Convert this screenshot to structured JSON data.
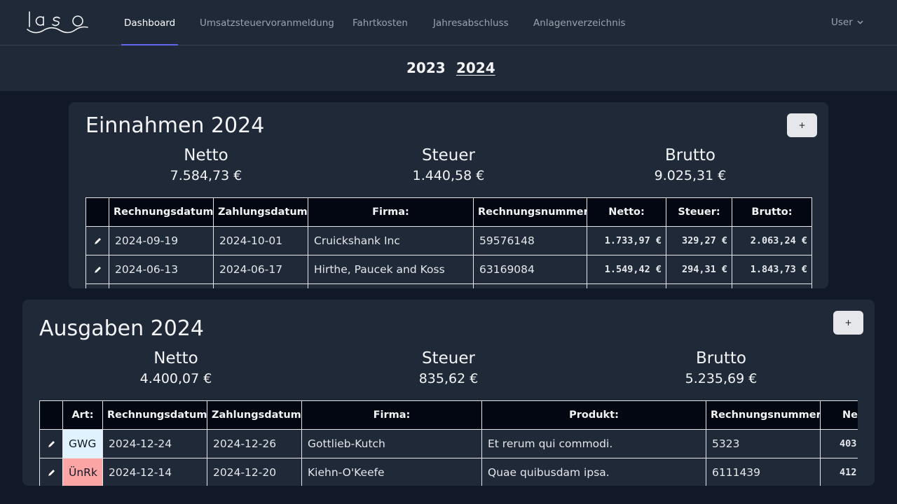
{
  "nav": {
    "items": [
      "Dashboard",
      "Umsatzsteuervoranmeldung",
      "Fahrtkosten",
      "Jahresabschluss",
      "Anlagenverzeichnis"
    ],
    "active": "Dashboard",
    "user_label": "User"
  },
  "years": {
    "items": [
      "2023",
      "2024"
    ],
    "active": "2024"
  },
  "income": {
    "title": "Einnahmen 2024",
    "add_label": "+",
    "summary": {
      "netto_label": "Netto",
      "netto_value": "7.584,73 €",
      "steuer_label": "Steuer",
      "steuer_value": "1.440,58 €",
      "brutto_label": "Brutto",
      "brutto_value": "9.025,31 €"
    },
    "columns": [
      "",
      "Rechnungsdatum:",
      "Zahlungsdatum:",
      "Firma:",
      "Rechnungsnummer:",
      "Netto:",
      "Steuer:",
      "Brutto:"
    ],
    "rows": [
      {
        "rechnungsdatum": "2024-09-19",
        "zahlungsdatum": "2024-10-01",
        "firma": "Cruickshank Inc",
        "rechnungsnummer": "59576148",
        "netto": "1.733,97 €",
        "steuer": "329,27 €",
        "brutto": "2.063,24 €"
      },
      {
        "rechnungsdatum": "2024-06-13",
        "zahlungsdatum": "2024-06-17",
        "firma": "Hirthe, Paucek and Koss",
        "rechnungsnummer": "63169084",
        "netto": "1.549,42 €",
        "steuer": "294,31 €",
        "brutto": "1.843,73 €"
      }
    ]
  },
  "expenses": {
    "title": "Ausgaben 2024",
    "add_label": "+",
    "summary": {
      "netto_label": "Netto",
      "netto_value": "4.400,07 €",
      "steuer_label": "Steuer",
      "steuer_value": "835,62 €",
      "brutto_label": "Brutto",
      "brutto_value": "5.235,69 €"
    },
    "columns": [
      "",
      "Art:",
      "Rechnungsdatum:",
      "Zahlungsdatum:",
      "Firma:",
      "Produkt:",
      "Rechnungsnummer:",
      "Netto:"
    ],
    "rows": [
      {
        "art": "GWG",
        "art_color": "#e0f2fe",
        "rechnungsdatum": "2024-12-24",
        "zahlungsdatum": "2024-12-26",
        "firma": "Gottlieb-Kutch",
        "produkt": "Et rerum qui commodi.",
        "rechnungsnummer": "5323",
        "netto": "403"
      },
      {
        "art": "ÜnRk",
        "art_color": "#fca5a5",
        "rechnungsdatum": "2024-12-14",
        "zahlungsdatum": "2024-12-20",
        "firma": "Kiehn-O'Keefe",
        "produkt": "Quae quibusdam ipsa.",
        "rechnungsnummer": "6111439",
        "netto": "412"
      }
    ]
  },
  "colors": {
    "background": "#111827",
    "card": "#1f2937",
    "accent": "#6366f1",
    "table_header": "#030712"
  }
}
